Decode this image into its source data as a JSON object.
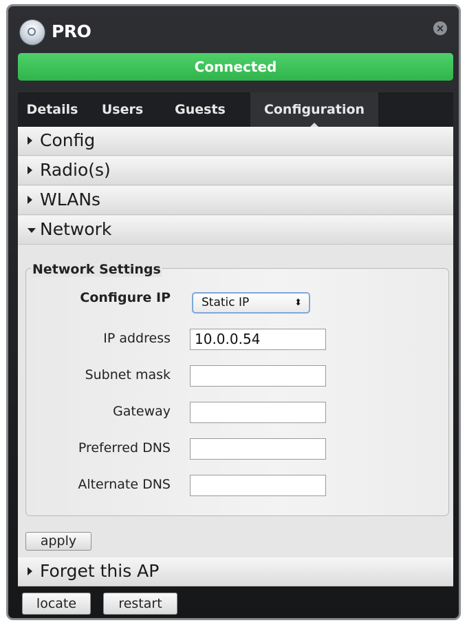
{
  "window": {
    "title": "PRO",
    "close_glyph": "×",
    "logo_icon": "ubiquiti-logo-icon"
  },
  "status": {
    "text": "Connected",
    "color": "#3cc257"
  },
  "tabs": [
    {
      "label": "Details",
      "active": false
    },
    {
      "label": "Users",
      "active": false
    },
    {
      "label": "Guests",
      "active": false
    },
    {
      "label": "Configuration",
      "active": true
    }
  ],
  "sections": {
    "config": "Config",
    "radios": "Radio(s)",
    "wlans": "WLANs",
    "network": "Network",
    "forget": "Forget this AP"
  },
  "network_settings": {
    "legend": "Network Settings",
    "configure_ip_label": "Configure IP",
    "configure_ip_value": "Static IP",
    "select_caret": "⬍",
    "ip_address_label": "IP address",
    "ip_address_value": "10.0.0.54",
    "subnet_mask_label": "Subnet mask",
    "subnet_mask_value": "",
    "gateway_label": "Gateway",
    "gateway_value": "",
    "preferred_dns_label": "Preferred DNS",
    "preferred_dns_value": "",
    "alternate_dns_label": "Alternate DNS",
    "alternate_dns_value": ""
  },
  "buttons": {
    "apply": "apply",
    "locate": "locate",
    "restart": "restart"
  }
}
